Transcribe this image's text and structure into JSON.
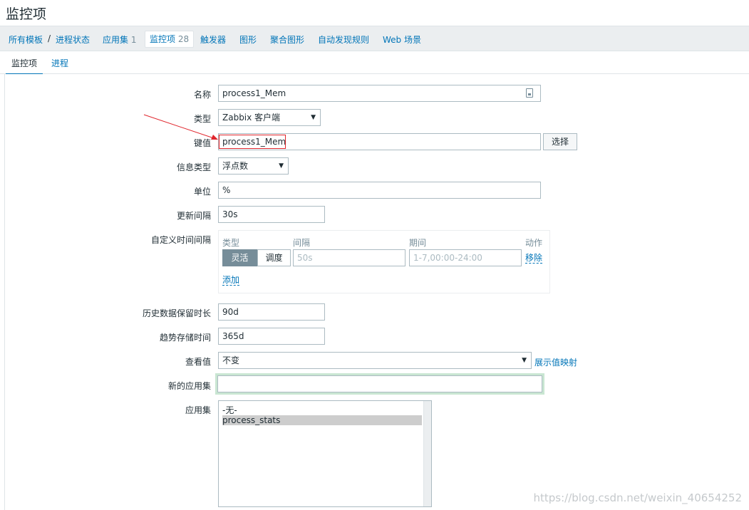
{
  "page": {
    "title": "监控项"
  },
  "breadcrumb": {
    "all_templates": "所有模板",
    "separator": "/",
    "template": "进程状态",
    "applications": "应用集",
    "applications_count": "1",
    "items": "监控项",
    "items_count": "28",
    "triggers": "触发器",
    "graphs": "图形",
    "screens": "聚合图形",
    "discovery": "自动发现规则",
    "web": "Web 场景"
  },
  "tabs": {
    "item": "监控项",
    "process": "进程"
  },
  "form": {
    "name": {
      "label": "名称",
      "value": "process1_Mem"
    },
    "type": {
      "label": "类型",
      "value": "Zabbix 客户端"
    },
    "key": {
      "label": "键值",
      "value": "process1_Mem",
      "button": "选择"
    },
    "info_type": {
      "label": "信息类型",
      "value": "浮点数"
    },
    "units": {
      "label": "单位",
      "value": "%"
    },
    "update_interval": {
      "label": "更新间隔",
      "value": "30s"
    },
    "custom_intervals": {
      "label": "自定义时间间隔",
      "col_type": "类型",
      "col_interval": "间隔",
      "col_period": "期间",
      "col_action": "动作",
      "flexible": "灵活",
      "scheduling": "调度",
      "interval_placeholder": "50s",
      "period_placeholder": "1-7,00:00-24:00",
      "remove": "移除",
      "add": "添加"
    },
    "history": {
      "label": "历史数据保留时长",
      "value": "90d"
    },
    "trends": {
      "label": "趋势存储时间",
      "value": "365d"
    },
    "valuemap": {
      "label": "查看值",
      "value": "不变",
      "link": "展示值映射"
    },
    "new_application": {
      "label": "新的应用集",
      "value": ""
    },
    "applications": {
      "label": "应用集",
      "options": [
        "-无-",
        "process_stats"
      ]
    }
  },
  "watermark": "https://blog.csdn.net/weixin_40654252",
  "colors": {
    "link": "#0275b8",
    "annotation": "#e0262d",
    "highlight_border": "#c9e6d2"
  }
}
